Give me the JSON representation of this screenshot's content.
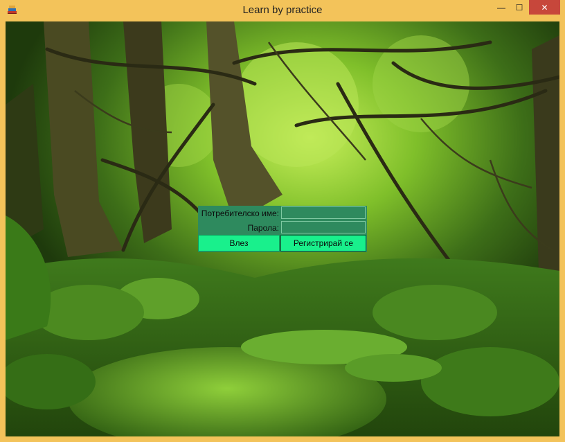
{
  "window": {
    "title": "Learn by practice",
    "minimize_glyph": "—",
    "maximize_glyph": "☐",
    "close_glyph": "✕",
    "app_icon": "books-icon"
  },
  "login": {
    "username_label": "Потребителско име:",
    "username_value": "",
    "password_label": "Парола:",
    "password_value": "",
    "login_button": "Влез",
    "register_button": "Регистрирай се"
  },
  "colors": {
    "title_bar": "#f3c35a",
    "close_button": "#c7473b",
    "panel": "#2e8a5e",
    "buttons": "#19f08c"
  }
}
